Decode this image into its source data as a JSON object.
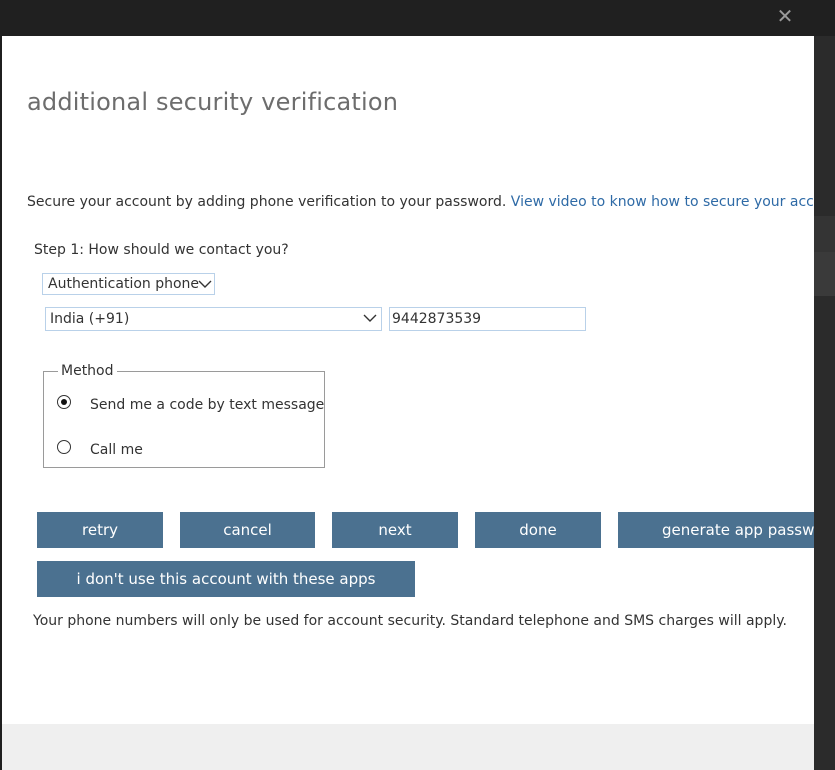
{
  "window": {
    "close_glyph": "✕",
    "colors": {
      "button_bg": "#4b7190",
      "link": "#2e6aa6",
      "title": "#6d6d6d",
      "field_border": "#b9d1e9"
    }
  },
  "page": {
    "title": "additional security verification",
    "intro_text": "Secure your account by adding phone verification to your password.",
    "intro_link": "View video to know how to secure your account",
    "step1_label": "Step 1: How should we contact you?"
  },
  "contact": {
    "method_select": {
      "value": "Authentication phone"
    },
    "country_select": {
      "value": "India (+91)"
    },
    "phone_input": {
      "value": "9442873539"
    }
  },
  "method": {
    "legend": "Method",
    "options": [
      {
        "label": "Send me a code by text message",
        "selected": true
      },
      {
        "label": "Call me",
        "selected": false
      }
    ]
  },
  "buttons": {
    "retry": "retry",
    "cancel": "cancel",
    "next": "next",
    "done": "done",
    "generate": "generate app passwo",
    "no_apps": "i don't use this account with these apps"
  },
  "footer_note": "Your phone numbers will only be used for account security. Standard telephone and SMS charges will apply."
}
